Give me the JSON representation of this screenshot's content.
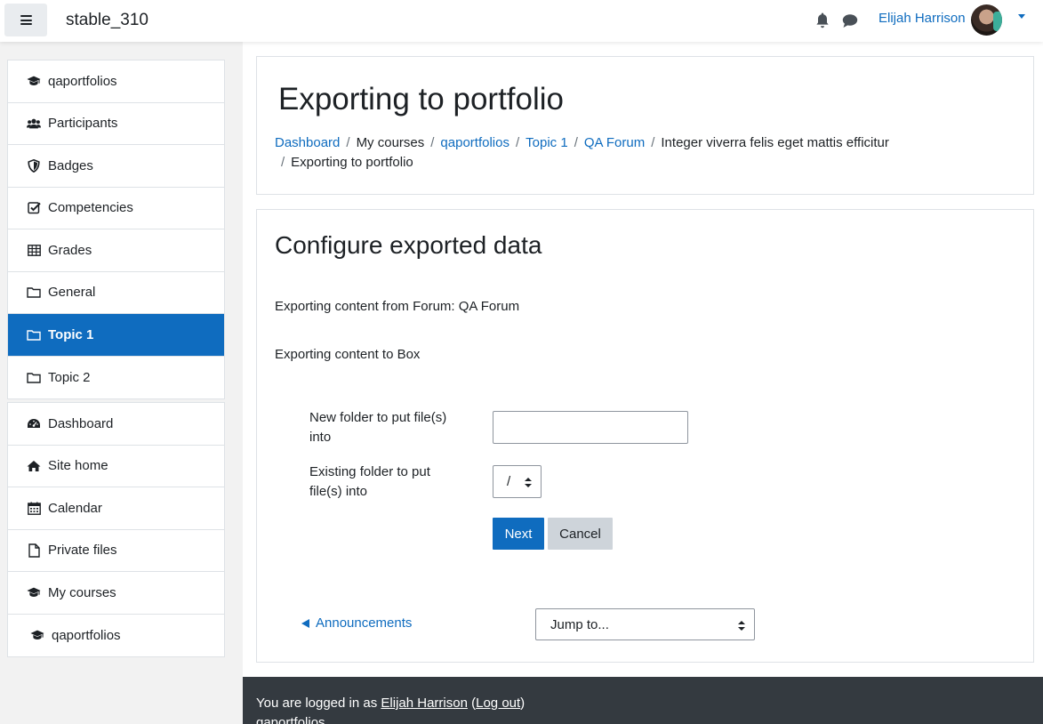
{
  "navbar": {
    "site_name": "stable_310",
    "user_name": "Elijah Harrison",
    "icons": [
      "menu-icon",
      "bell-icon",
      "chat-icon",
      "avatar",
      "caret-down-icon"
    ]
  },
  "sidebar": {
    "course_nav": [
      {
        "label": "qaportfolios",
        "icon": "graduation-cap-icon"
      },
      {
        "label": "Participants",
        "icon": "users-icon"
      },
      {
        "label": "Badges",
        "icon": "shield-icon"
      },
      {
        "label": "Competencies",
        "icon": "check-square-icon"
      },
      {
        "label": "Grades",
        "icon": "table-icon"
      },
      {
        "label": "General",
        "icon": "folder-icon"
      },
      {
        "label": "Topic 1",
        "icon": "folder-icon",
        "active": true
      },
      {
        "label": "Topic 2",
        "icon": "folder-icon"
      }
    ],
    "site_nav": [
      {
        "label": "Dashboard",
        "icon": "dashboard-icon"
      },
      {
        "label": "Site home",
        "icon": "home-icon"
      },
      {
        "label": "Calendar",
        "icon": "calendar-icon"
      },
      {
        "label": "Private files",
        "icon": "file-icon"
      },
      {
        "label": "My courses",
        "icon": "graduation-cap-icon"
      },
      {
        "label": "qaportfolios",
        "icon": "graduation-cap-icon"
      }
    ]
  },
  "header": {
    "title": "Exporting to portfolio",
    "breadcrumb": [
      {
        "label": "Dashboard",
        "link": true
      },
      {
        "label": "My courses",
        "link": false
      },
      {
        "label": "qaportfolios",
        "link": true
      },
      {
        "label": "Topic 1",
        "link": true
      },
      {
        "label": "QA Forum",
        "link": true
      },
      {
        "label": "Integer viverra felis eget mattis efficitur",
        "link": false
      },
      {
        "label": "Exporting to portfolio",
        "link": false
      }
    ],
    "separator": "/"
  },
  "content": {
    "section_title": "Configure exported data",
    "export_from": "Exporting content from Forum: QA Forum",
    "export_to": "Exporting content to Box",
    "new_folder_label": "New folder to put file(s) into",
    "new_folder_value": "",
    "existing_folder_label": "Existing folder to put file(s) into",
    "existing_folder_value": "/",
    "next_button": "Next",
    "cancel_button": "Cancel",
    "prev_activity_link": "Announcements",
    "jump_to": "Jump to..."
  },
  "footer": {
    "logged_in_prefix": "You are logged in as",
    "user_name": "Elijah Harrison",
    "logout_label": "Log out",
    "course_name": "qaportfolios"
  },
  "colors": {
    "primary": "#0f6cbf",
    "footer_bg": "#343a40",
    "secondary_btn": "#ced4da",
    "sidebar_bg": "#f2f2f2"
  }
}
